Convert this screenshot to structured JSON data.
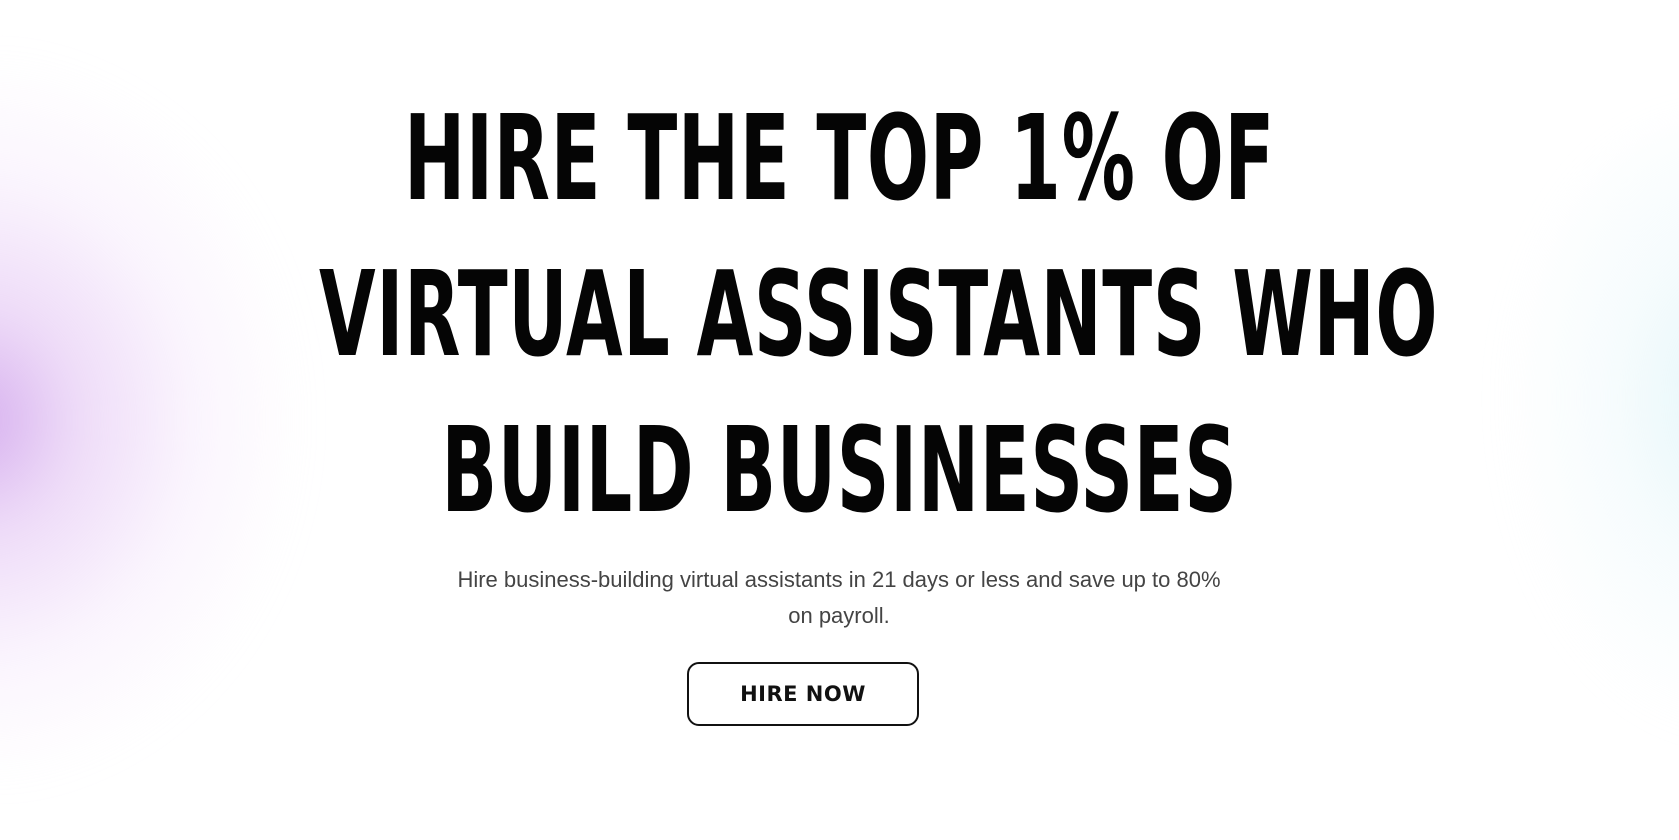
{
  "hero": {
    "headline_lines": [
      "Hire the top 1% of",
      "virtual assistants who",
      "build businesses"
    ],
    "subtitle": "Hire business-building virtual assistants in 21 days or less and save up to 80% on payroll.",
    "cta_label": "HIRE NOW"
  },
  "colors": {
    "background": "#ffffff",
    "text": "#050505",
    "subtitle_text": "#444444",
    "left_glow": "#cea0eb",
    "right_glow": "#d2f0f5"
  }
}
